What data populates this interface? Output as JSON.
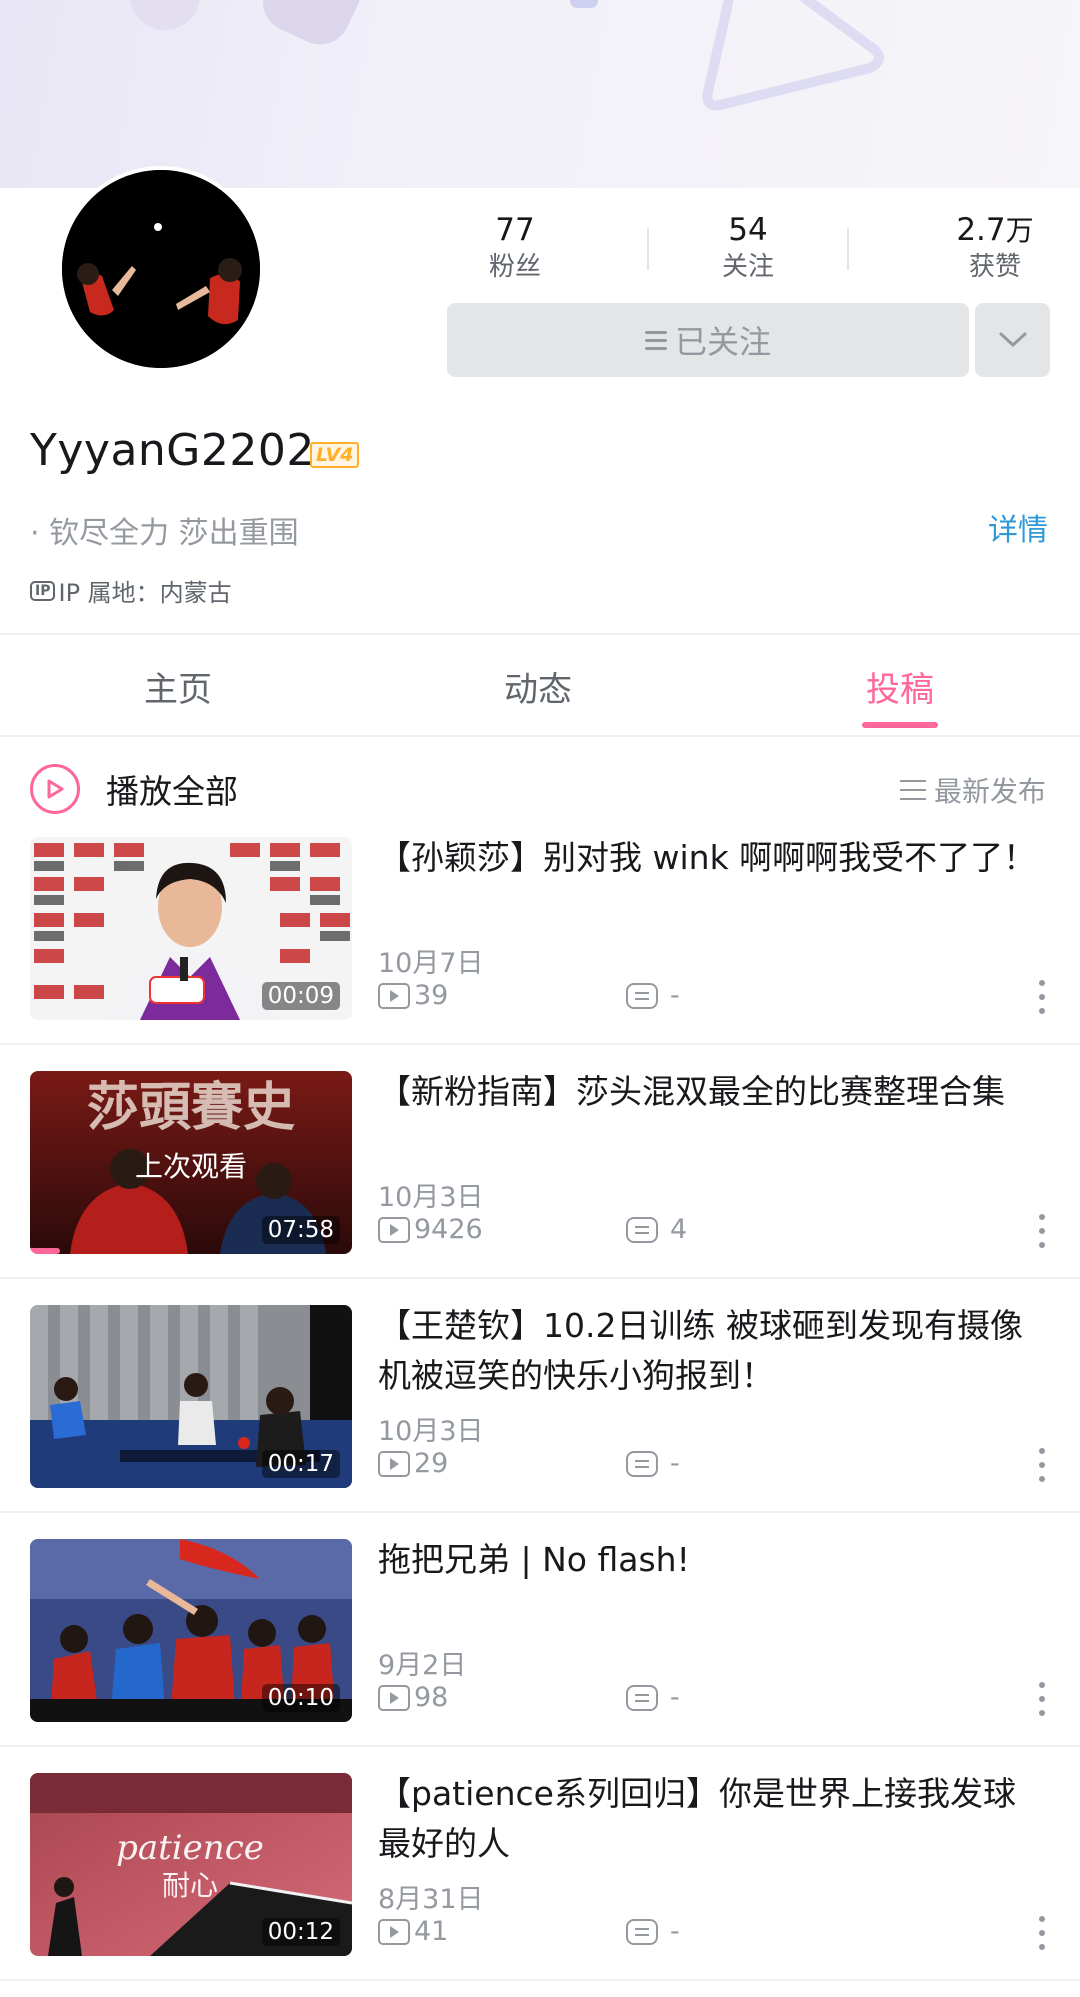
{
  "profile": {
    "username": "YyyanG2202",
    "level": "LV4",
    "signature": "· 钦尽全力 莎出重围",
    "detail_link": "详情",
    "ip_badge": "IP",
    "ip_location": "IP 属地：内蒙古",
    "follow_button": "已关注",
    "stats": [
      {
        "value": "77",
        "unit": "",
        "label": "粉丝"
      },
      {
        "value": "54",
        "unit": "",
        "label": "关注"
      },
      {
        "value": "2.7",
        "unit": "万",
        "label": "获赞"
      }
    ]
  },
  "tabs": [
    {
      "label": "主页",
      "active": false
    },
    {
      "label": "动态",
      "active": false
    },
    {
      "label": "投稿",
      "active": true
    }
  ],
  "list_header": {
    "play_all": "播放全部",
    "sort": "最新发布"
  },
  "colors": {
    "accent": "#ff6699",
    "link": "#2f99d8",
    "level": "#ffb027",
    "muted": "#9499a0"
  },
  "videos": [
    {
      "title": "【孙颖莎】别对我 wink 啊啊啊我受不了了！",
      "date": "10月7日",
      "plays": "39",
      "comments": "-",
      "duration": "00:09",
      "watched_label": ""
    },
    {
      "title": "【新粉指南】莎头混双最全的比赛整理合集",
      "date": "10月3日",
      "plays": "9426",
      "comments": "4",
      "duration": "07:58",
      "watched_label": "上次观看"
    },
    {
      "title": "【王楚钦】10.2日训练 被球砸到发现有摄像机被逗笑的快乐小狗报到！",
      "date": "10月3日",
      "plays": "29",
      "comments": "-",
      "duration": "00:17",
      "watched_label": ""
    },
    {
      "title": "拖把兄弟 | No flash!",
      "date": "9月2日",
      "plays": "98",
      "comments": "-",
      "duration": "00:10",
      "watched_label": ""
    },
    {
      "title": "【patience系列回归】你是世界上接我发球最好的人",
      "date": "8月31日",
      "plays": "41",
      "comments": "-",
      "duration": "00:12",
      "watched_label": ""
    }
  ]
}
